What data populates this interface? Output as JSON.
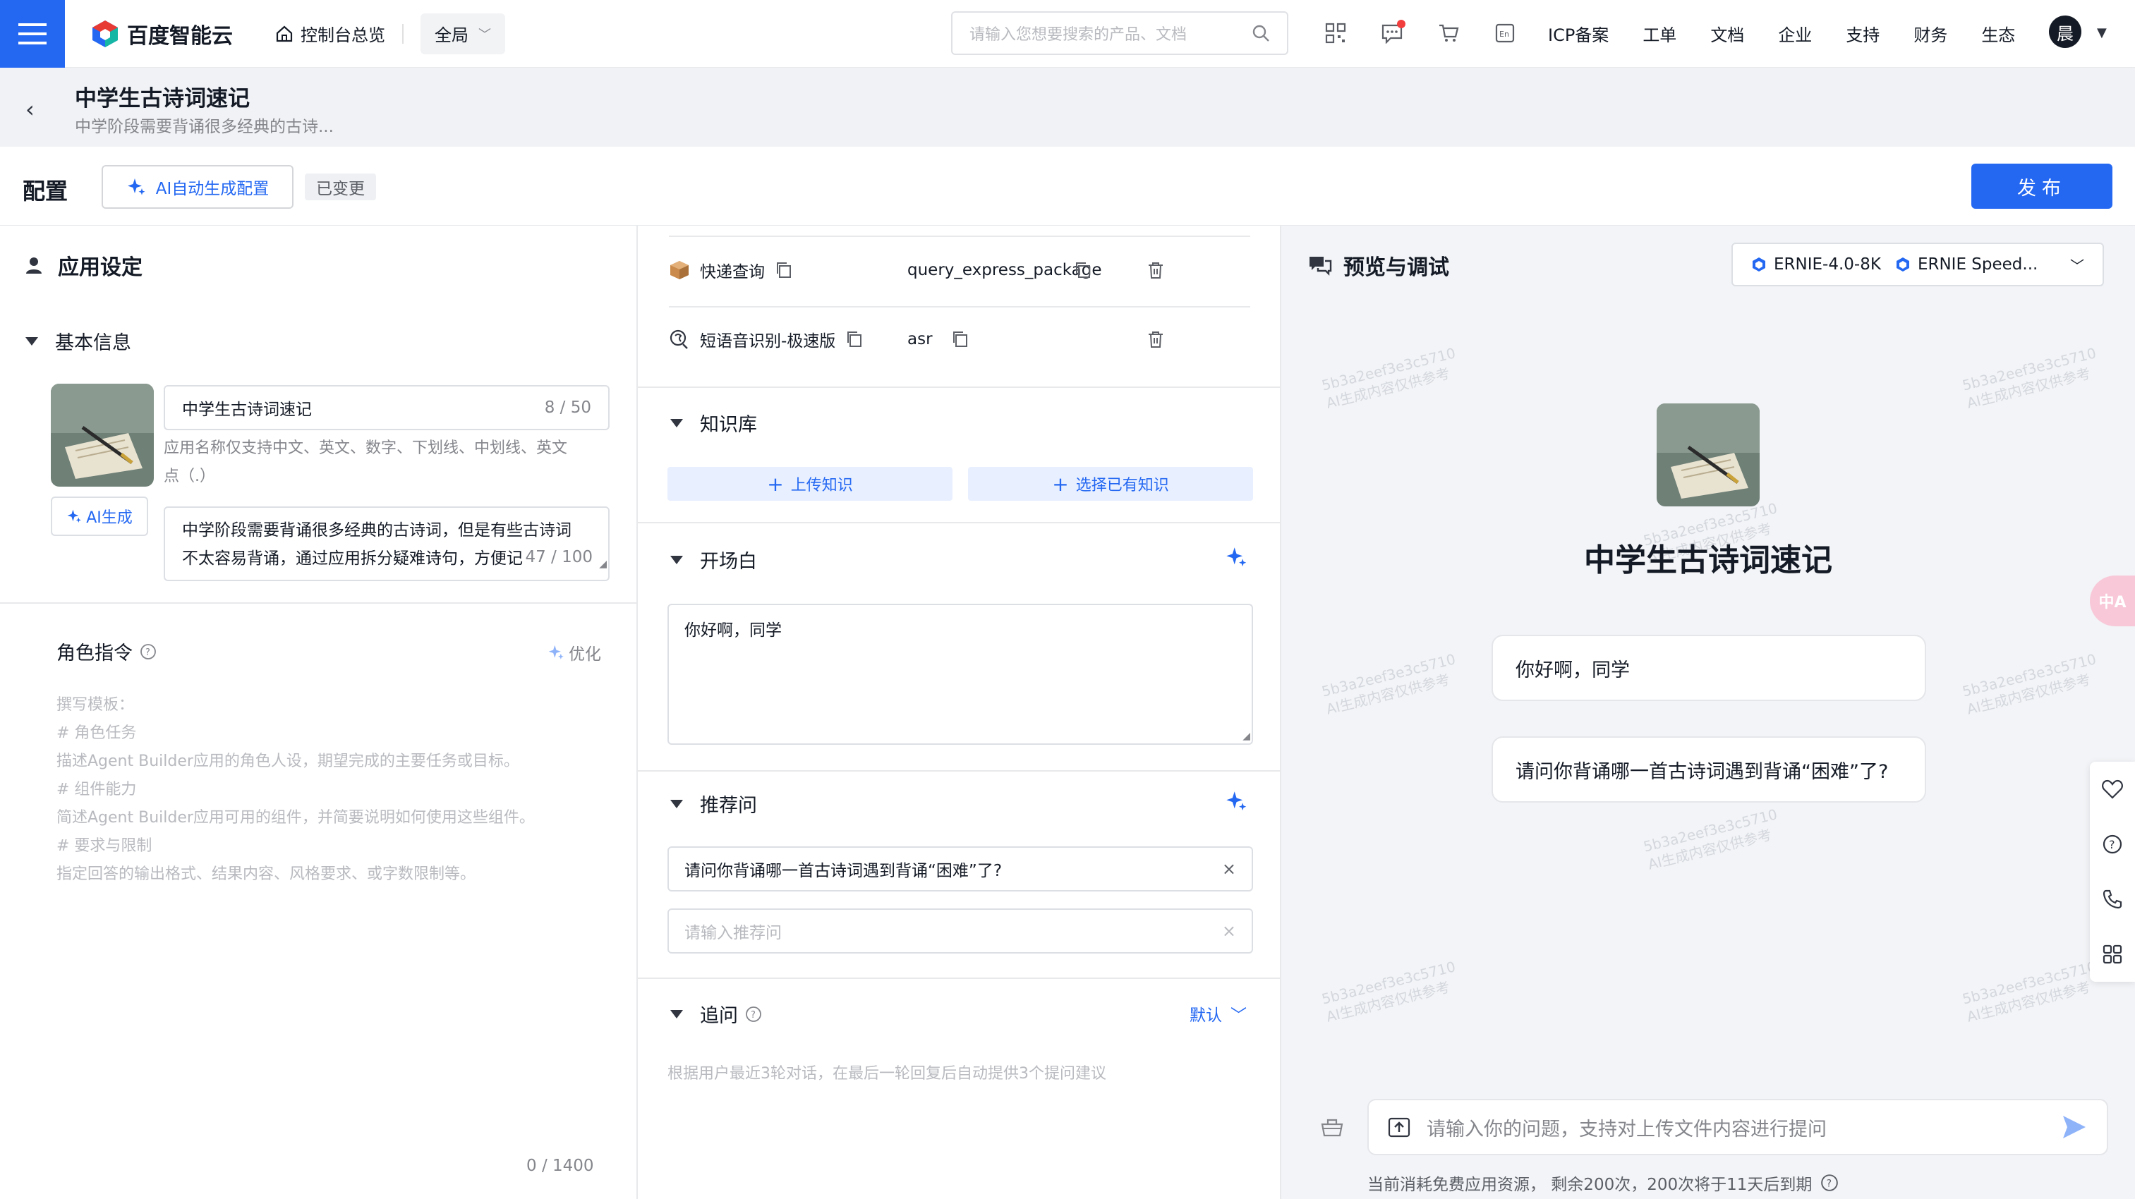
{
  "topbar": {
    "brand": "百度智能云",
    "console_home": "控制台总览",
    "region": "全局",
    "search_placeholder": "请输入您想要搜索的产品、文档",
    "links": [
      "ICP备案",
      "工单",
      "文档",
      "企业",
      "支持",
      "财务",
      "生态"
    ],
    "avatar_char": "晨"
  },
  "app": {
    "title": "中学生古诗词速记",
    "subtitle": "中学阶段需要背诵很多经典的古诗..."
  },
  "config": {
    "label": "配置",
    "ai_config": "AI自动生成配置",
    "changed": "已变更",
    "publish": "发布"
  },
  "settings": {
    "title": "应用设定",
    "basic_info": "基本信息",
    "name_value": "中学生古诗词速记",
    "name_count": "8 / 50",
    "name_hint_1": "应用名称仅支持中文、英文、数字、下划线、中划线、英文",
    "name_hint_2": "点（.）",
    "ai_generate": "AI生成",
    "desc_value": "中学阶段需要背诵很多经典的古诗词，但是有些古诗词不太容易背诵，通过应用拆分疑难诗句，方便记",
    "desc_count": "47 / 100",
    "role_title": "角色指令",
    "optimize": "优化",
    "template_lines": [
      "撰写模板：",
      "# 角色任务",
      "描述Agent Builder应用的角色人设，期望完成的主要任务或目标。",
      "# 组件能力",
      "简述Agent Builder应用可用的组件，并简要说明如何使用这些组件。",
      "# 要求与限制",
      "指定回答的输出格式、结果内容、风格要求、或字数限制等。"
    ],
    "role_count": "0 / 1400"
  },
  "tools": [
    {
      "name": "快递查询",
      "id": "query_express_package"
    },
    {
      "name": "短语音识别-极速版",
      "id": "asr"
    }
  ],
  "knowledge": {
    "title": "知识库",
    "upload": "上传知识",
    "select": "选择已有知识"
  },
  "opening": {
    "title": "开场白",
    "value": "你好啊，同学"
  },
  "recommend": {
    "title": "推荐问",
    "q1": "请问你背诵哪一首古诗词遇到背诵“困难”了?",
    "placeholder": "请输入推荐问"
  },
  "followup": {
    "title": "追问",
    "mode": "默认",
    "desc": "根据用户最近3轮对话，在最后一轮回复后自动提供3个提问建议"
  },
  "preview": {
    "title": "预览与调试",
    "model_1": "ERNIE-4.0-8K",
    "model_2": "ERNIE Speed...",
    "app_name": "中学生古诗词速记",
    "greeting": "你好啊，同学",
    "suggested": "请问你背诵哪一首古诗词遇到背诵“困难”了?",
    "input_placeholder": "请输入你的问题，支持对上传文件内容进行提问",
    "quota": "当前消耗免费应用资源， 剩余200次，200次将于11天后到期",
    "watermark_1": "5b3a2eef3e3c5710",
    "watermark_2": "AI生成内容仅供参考",
    "badge": "中A"
  },
  "colors": {
    "primary": "#2468f2",
    "text": "#151b26",
    "muted": "#84868c"
  }
}
